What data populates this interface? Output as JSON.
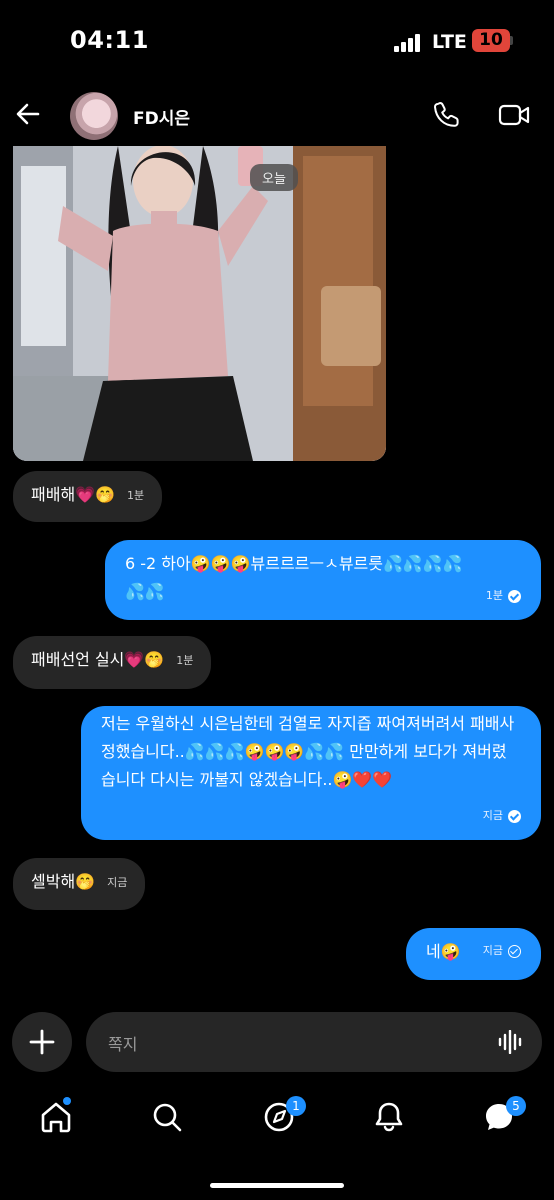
{
  "status_bar": {
    "time": "04:11",
    "network": "LTE",
    "battery": "10"
  },
  "header": {
    "name": "FD시은"
  },
  "image_message": {
    "date_chip": "오늘"
  },
  "messages": [
    {
      "direction": "in",
      "text": "패배해💗🤭",
      "time": "1분"
    },
    {
      "direction": "out",
      "text": "6 -2 하아🤪🤪🤪뷰르르르ㅡㅅ뷰르릇💦💦💦💦💦💦",
      "time": "1분"
    },
    {
      "direction": "in",
      "text": "패배선언 실시💗🤭",
      "time": "1분"
    },
    {
      "direction": "out",
      "text": "저는 우월하신 시은님한테 검열로 자지즙 짜여져버려서 패배사정했습니다..💦💦💦🤪🤪🤪💦💦  만만하게 보다가 져버렸습니다 다시는 까불지 않겠습니다..🤪❤️❤️",
      "time": "지금"
    },
    {
      "direction": "in",
      "text": "셀박해🤭",
      "time": "지금"
    },
    {
      "direction": "out",
      "text": "네🤪",
      "time": "지금"
    }
  ],
  "composer": {
    "placeholder": "쪽지"
  },
  "nav": {
    "items": [
      {
        "icon": "home-icon"
      },
      {
        "icon": "search-icon"
      },
      {
        "icon": "explore-icon",
        "badge": "1"
      },
      {
        "icon": "bell-icon"
      },
      {
        "icon": "messages-icon",
        "badge": "5"
      }
    ]
  },
  "colors": {
    "accent": "#1e90ff",
    "incoming_bubble": "#262626",
    "battery_low": "#e0453a"
  }
}
